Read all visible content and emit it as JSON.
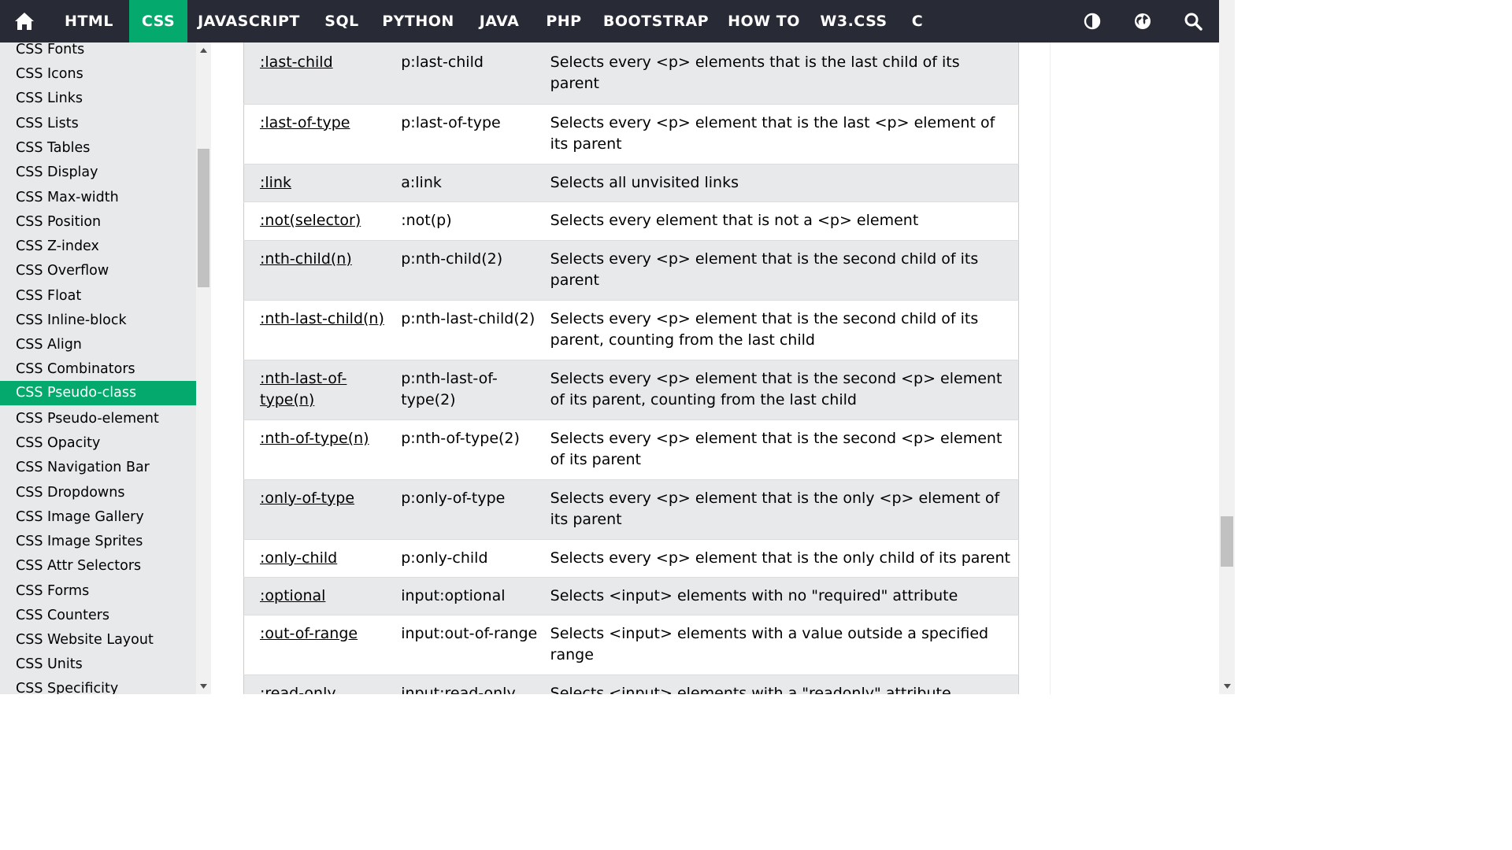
{
  "topnav": {
    "items": [
      "HTML",
      "CSS",
      "JAVASCRIPT",
      "SQL",
      "PYTHON",
      "JAVA",
      "PHP",
      "BOOTSTRAP",
      "HOW TO",
      "W3.CSS",
      "C"
    ],
    "active": "CSS",
    "accent_color": "#04aa6d",
    "bar_color": "#282a35",
    "icons": [
      "home-icon",
      "contrast-icon",
      "globe-icon",
      "search-icon"
    ]
  },
  "sidebar": {
    "items": [
      "CSS Fonts",
      "CSS Icons",
      "CSS Links",
      "CSS Lists",
      "CSS Tables",
      "CSS Display",
      "CSS Max-width",
      "CSS Position",
      "CSS Z-index",
      "CSS Overflow",
      "CSS Float",
      "CSS Inline-block",
      "CSS Align",
      "CSS Combinators",
      "CSS Pseudo-class",
      "CSS Pseudo-element",
      "CSS Opacity",
      "CSS Navigation Bar",
      "CSS Dropdowns",
      "CSS Image Gallery",
      "CSS Image Sprites",
      "CSS Attr Selectors",
      "CSS Forms",
      "CSS Counters",
      "CSS Website Layout",
      "CSS Units",
      "CSS Specificity"
    ],
    "active": "CSS Pseudo-class"
  },
  "table": {
    "rows": [
      {
        "selector": ":last-child",
        "example": "p:last-child",
        "description": "Selects every <p> elements that is the last child of its parent"
      },
      {
        "selector": ":last-of-type",
        "example": "p:last-of-type",
        "description": "Selects every <p> element that is the last <p> element of its parent"
      },
      {
        "selector": ":link",
        "example": "a:link",
        "description": "Selects all unvisited links"
      },
      {
        "selector": ":not(selector)",
        "example": ":not(p)",
        "description": "Selects every element that is not a <p> element"
      },
      {
        "selector": ":nth-child(n)",
        "example": "p:nth-child(2)",
        "description": "Selects every <p> element that is the second child of its parent"
      },
      {
        "selector": ":nth-last-child(n)",
        "example": "p:nth-last-child(2)",
        "description": "Selects every <p> element that is the second child of its parent, counting from the last child"
      },
      {
        "selector": ":nth-last-of-type(n)",
        "example": "p:nth-last-of-type(2)",
        "description": "Selects every <p> element that is the second <p> element of its parent, counting from the last child"
      },
      {
        "selector": ":nth-of-type(n)",
        "example": "p:nth-of-type(2)",
        "description": "Selects every <p> element that is the second <p> element of its parent"
      },
      {
        "selector": ":only-of-type",
        "example": "p:only-of-type",
        "description": "Selects every <p> element that is the only <p> element of its parent"
      },
      {
        "selector": ":only-child",
        "example": "p:only-child",
        "description": "Selects every <p> element that is the only child of its parent"
      },
      {
        "selector": ":optional",
        "example": "input:optional",
        "description": "Selects <input> elements with no \"required\" attribute"
      },
      {
        "selector": ":out-of-range",
        "example": "input:out-of-range",
        "description": "Selects <input> elements with a value outside a specified range"
      },
      {
        "selector": ":read-only",
        "example": "input:read-only",
        "description": "Selects <input> elements with a \"readonly\" attribute"
      }
    ]
  }
}
